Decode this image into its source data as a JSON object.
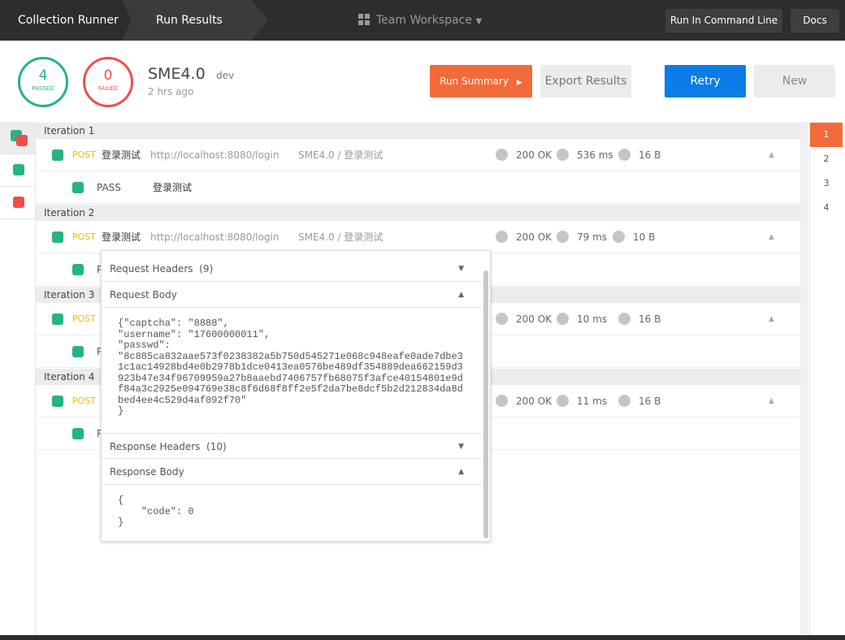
{
  "topbar": {
    "crumbs": [
      "Collection Runner",
      "Run Results"
    ],
    "workspace": "Team Workspace",
    "run_cli": "Run In Command Line",
    "docs": "Docs"
  },
  "summary": {
    "passed": "4",
    "passed_label": "PASSED",
    "failed": "0",
    "failed_label": "FAILED",
    "collection": "SME4.0",
    "environment": "dev",
    "time": "2 hrs ago"
  },
  "actions": {
    "run_summary": "Run Summary",
    "export": "Export Results",
    "retry": "Retry",
    "new": "New"
  },
  "colors": {
    "accent": "#f26b3a",
    "pass": "#26b47f",
    "fail": "#ef4d4d",
    "retry": "#0b7ce8",
    "method": "#f5b800"
  },
  "iterations": [
    {
      "label": "Iteration 1",
      "method": "POST",
      "name": "登录测试",
      "url": "http://localhost:8080/login",
      "path": "SME4.0 / 登录测试",
      "status": "200 OK",
      "time": "536 ms",
      "size": "16 B",
      "test_result": "PASS",
      "test_name": "登录测试"
    },
    {
      "label": "Iteration 2",
      "method": "POST",
      "name": "登录测试",
      "url": "http://localhost:8080/login",
      "path": "SME4.0 / 登录测试",
      "status": "200 OK",
      "time": "79 ms",
      "size": "10 B",
      "test_result": "P"
    },
    {
      "label": "Iteration 3",
      "method": "POST",
      "status": "200 OK",
      "time": "10 ms",
      "size": "16 B",
      "test_result": "P"
    },
    {
      "label": "Iteration 4",
      "method": "POST",
      "status": "200 OK",
      "time": "11 ms",
      "size": "16 B",
      "test_result": "P"
    }
  ],
  "popup": {
    "req_headers": "Request Headers",
    "req_headers_count": "(9)",
    "req_body": "Request Body",
    "req_body_text": "{\"captcha\": \"8888\",\n\"username\": \"17600000011\",\n\"passwd\":\n\"8c885ca832aae573f0238382a5b750d545271e068c948eafe0ade7dbe3\n1c1ac14928bd4e0b2978b1dce0413ea0576be489df354889dea662159d3\n923b47e34f96709959a27b8aaebd7406757fb68075f3afce40154801e9d\nf84a3c2925e094769e38c8f6d68f8ff2e5f2da7be8dcf5b2d212834da8d\nbed4ee4c529d4af092f70\"\n}",
    "resp_headers": "Response Headers",
    "resp_headers_count": "(10)",
    "resp_body": "Response Body",
    "resp_body_text": "{\n    \"code\": 0\n}"
  },
  "pages": [
    "1",
    "2",
    "3",
    "4"
  ]
}
